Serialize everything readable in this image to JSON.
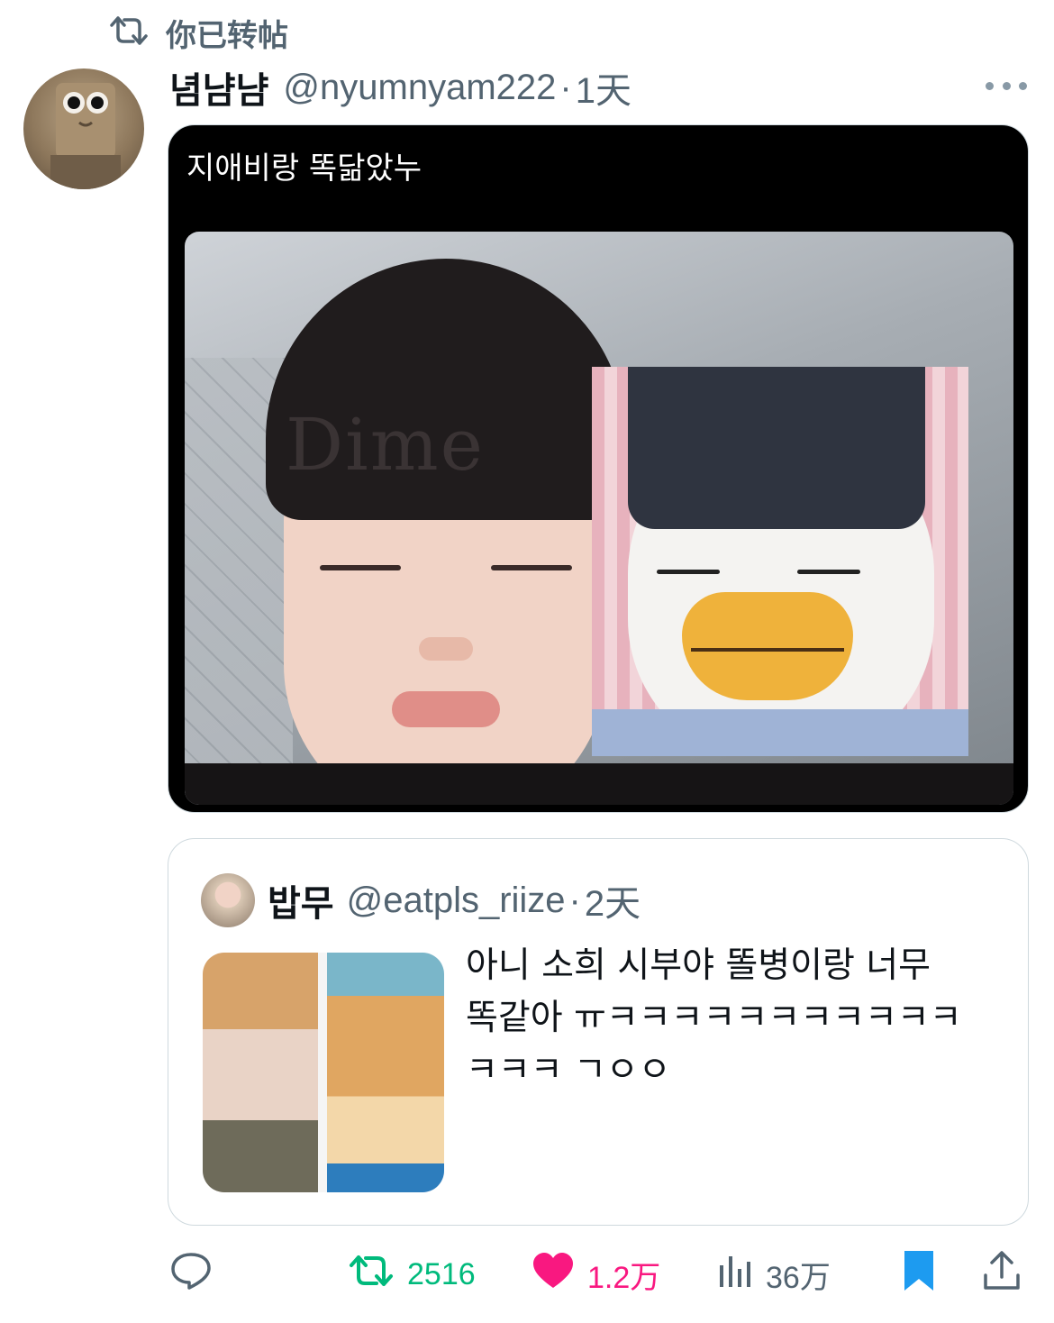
{
  "social_context": {
    "label": "你已转帖"
  },
  "tweet": {
    "author_name": "념냠냠",
    "author_handle": "@nyumnyam222",
    "separator": "·",
    "time": "1天",
    "media_caption": "지애비랑 똑닮았누",
    "beanie_text": "Dime"
  },
  "quoted_tweet": {
    "author_name": "밥무",
    "author_handle": "@eatpls_riize",
    "separator": "·",
    "time": "2天",
    "text_lines": [
      "아니 소희 시부야 똘병이랑 너무",
      "똑같아 ㅠㅋㅋㅋㅋㅋㅋㅋㅋㅋㅋㅋ",
      "ㅋㅋㅋ ㄱㅇㅇ"
    ]
  },
  "actions": {
    "retweets": "2516",
    "likes": "1.2万",
    "views": "36万"
  },
  "colors": {
    "retweet_green": "#00ba7c",
    "like_pink": "#f91880",
    "bookmark_blue": "#1d9bf0",
    "secondary_gray": "#536471"
  },
  "icons": [
    "retweet-icon",
    "more-icon",
    "reply-icon",
    "like-icon",
    "views-icon",
    "bookmark-icon",
    "share-icon"
  ]
}
